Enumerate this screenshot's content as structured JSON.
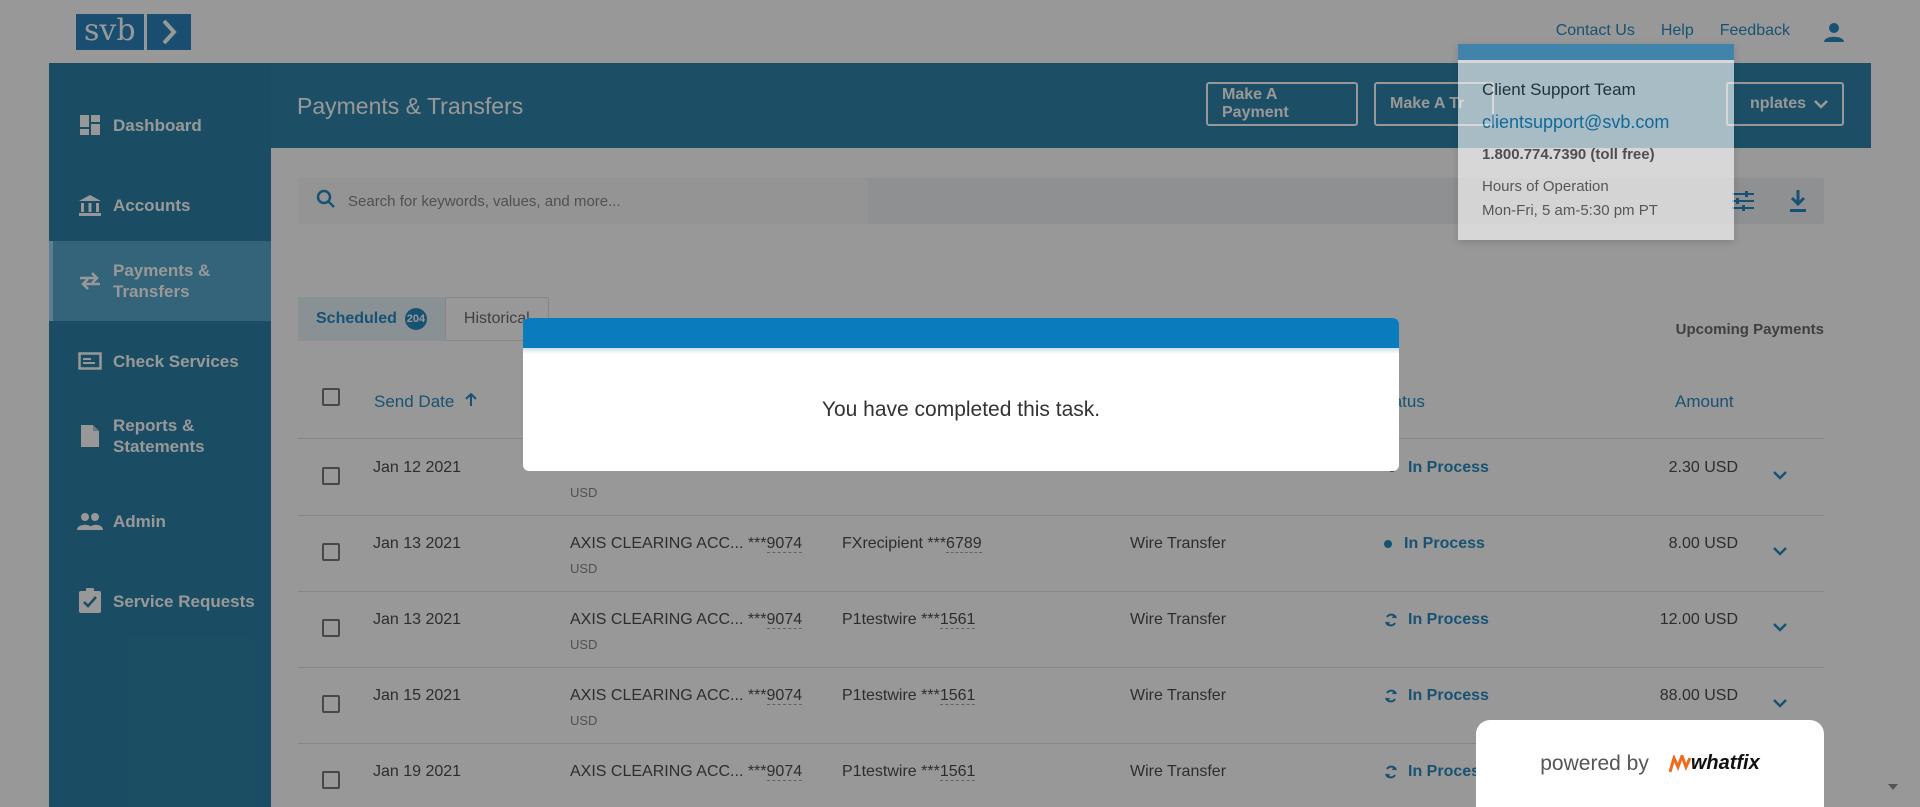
{
  "brand": {
    "logo_text": "svb"
  },
  "top_links": {
    "contact": "Contact Us",
    "help": "Help",
    "feedback": "Feedback"
  },
  "sidebar": {
    "items": [
      {
        "label": "Dashboard",
        "icon": "dashboard-icon"
      },
      {
        "label": "Accounts",
        "icon": "bank-icon"
      },
      {
        "label": "Payments &\nTransfers",
        "icon": "transfer-icon",
        "active": true
      },
      {
        "label": "Check Services",
        "icon": "check-icon"
      },
      {
        "label": "Reports &\nStatements",
        "icon": "document-icon"
      },
      {
        "label": "Admin",
        "icon": "people-icon"
      },
      {
        "label": "Service Requests",
        "icon": "clipboard-check-icon"
      }
    ]
  },
  "header": {
    "title": "Payments & Transfers",
    "btn_make_payment": "Make A Payment",
    "btn_make_transfer": "Make A Tr",
    "btn_templates": "nplates"
  },
  "search": {
    "placeholder": "Search for keywords, values, and more..."
  },
  "tabs": {
    "scheduled": "Scheduled",
    "scheduled_count": "204",
    "historical": "Historical"
  },
  "upcoming_label": "Upcoming Payments",
  "table": {
    "headers": {
      "send_date": "Send Date",
      "status": "tatus",
      "amount": "Amount"
    },
    "rows": [
      {
        "date": "Jan 12 2021",
        "from": "",
        "from_num": "",
        "currency": "USD",
        "to": "",
        "to_num": "",
        "type": "",
        "status": "In Process",
        "status_kind": "dot",
        "amount": "2.30 USD"
      },
      {
        "date": "Jan 13 2021",
        "from": "AXIS CLEARING ACC... ***",
        "from_num": "9074",
        "currency": "USD",
        "to": "FXrecipient ***",
        "to_num": "6789",
        "type": "Wire Transfer",
        "status": "In Process",
        "status_kind": "dot",
        "amount": "8.00 USD"
      },
      {
        "date": "Jan 13 2021",
        "from": "AXIS CLEARING ACC... ***",
        "from_num": "9074",
        "currency": "USD",
        "to": "P1testwire ***",
        "to_num": "1561",
        "type": "Wire Transfer",
        "status": "In Process",
        "status_kind": "sync",
        "amount": "12.00 USD"
      },
      {
        "date": "Jan 15 2021",
        "from": "AXIS CLEARING ACC... ***",
        "from_num": "9074",
        "currency": "USD",
        "to": "P1testwire ***",
        "to_num": "1561",
        "type": "Wire Transfer",
        "status": "In Process",
        "status_kind": "sync",
        "amount": "88.00 USD"
      },
      {
        "date": "Jan 19 2021",
        "from": "AXIS CLEARING ACC... ***",
        "from_num": "9074",
        "currency": "USD",
        "to": "P1testwire ***",
        "to_num": "1561",
        "type": "Wire Transfer",
        "status": "In Process",
        "status_kind": "sync",
        "amount": ""
      }
    ]
  },
  "support_card": {
    "team": "Client Support Team",
    "email": "clientsupport@svb.com",
    "phone": "1.800.774.7390 (toll free)",
    "hours_label": "Hours of Operation",
    "hours": "Mon-Fri, 5 am-5:30 pm PT"
  },
  "modal": {
    "message": "You have completed this task."
  },
  "powered": {
    "label": "powered by",
    "brand": "whatfix"
  },
  "colors": {
    "accent": "#0b79b8",
    "sidebar": "#0f6f9a",
    "header": "#13749f"
  }
}
